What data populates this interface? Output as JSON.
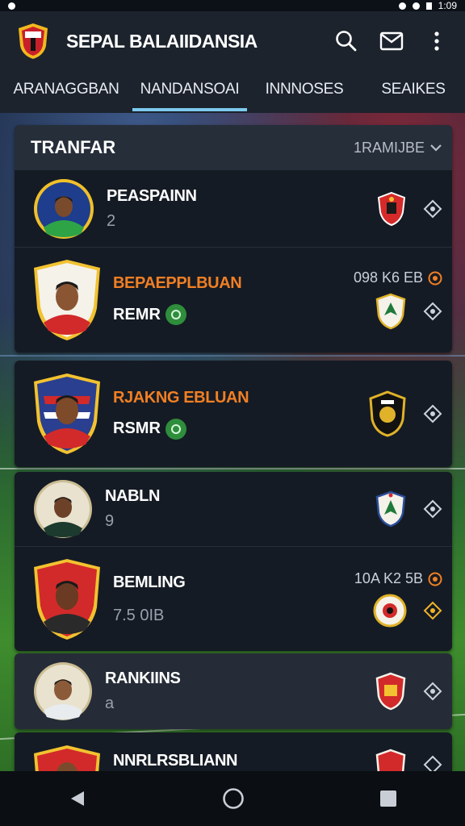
{
  "status_bar": {
    "time": "1:09"
  },
  "app": {
    "title": "SEPAL BALAIIDANSIA"
  },
  "tabs": [
    "ARANAGGBAN",
    "NANDANSOAI",
    "INNNOSES",
    "SEAIKES"
  ],
  "active_tab": 1,
  "card1": {
    "title": "TRANFAR",
    "sort_label": "1RAMIJBE",
    "rows": [
      {
        "name": "PEASPAINN",
        "sub": "2"
      },
      {
        "label": "BEPAEPPLBUAN",
        "name": "REMR",
        "value": "098 K6 EB"
      }
    ]
  },
  "card2": {
    "rows": [
      {
        "label": "RJAKNG EBLUAN",
        "name": "RSMR"
      }
    ]
  },
  "card3": {
    "rows": [
      {
        "name": "NABLN",
        "sub": "9"
      },
      {
        "name": "BEMLING",
        "sub": "7.5 0IB",
        "value": "10A K2 5B"
      }
    ]
  },
  "card4": {
    "rows": [
      {
        "name": "RANKIINS",
        "sub": "a"
      }
    ]
  },
  "card5": {
    "rows": [
      {
        "name": "NNRLRSBLIANN"
      }
    ]
  },
  "colors": {
    "accent": "#7dcaf0",
    "orange": "#f07f24",
    "card": "#151b24",
    "header": "#262e3a",
    "appbar": "#1c232d",
    "badge_green": "#2e8e3b"
  },
  "icons": {
    "app_logo": "shield-logo-icon",
    "search": "search-icon",
    "mail": "mail-icon",
    "more": "more-vertical-icon",
    "sort": "chevron-down-icon",
    "compare": "compare-icon",
    "position_badge": "position-badge-icon",
    "club": "club-crest-icon",
    "nav_back": "back-triangle-icon",
    "nav_home": "home-circle-icon",
    "nav_recents": "recents-square-icon"
  }
}
